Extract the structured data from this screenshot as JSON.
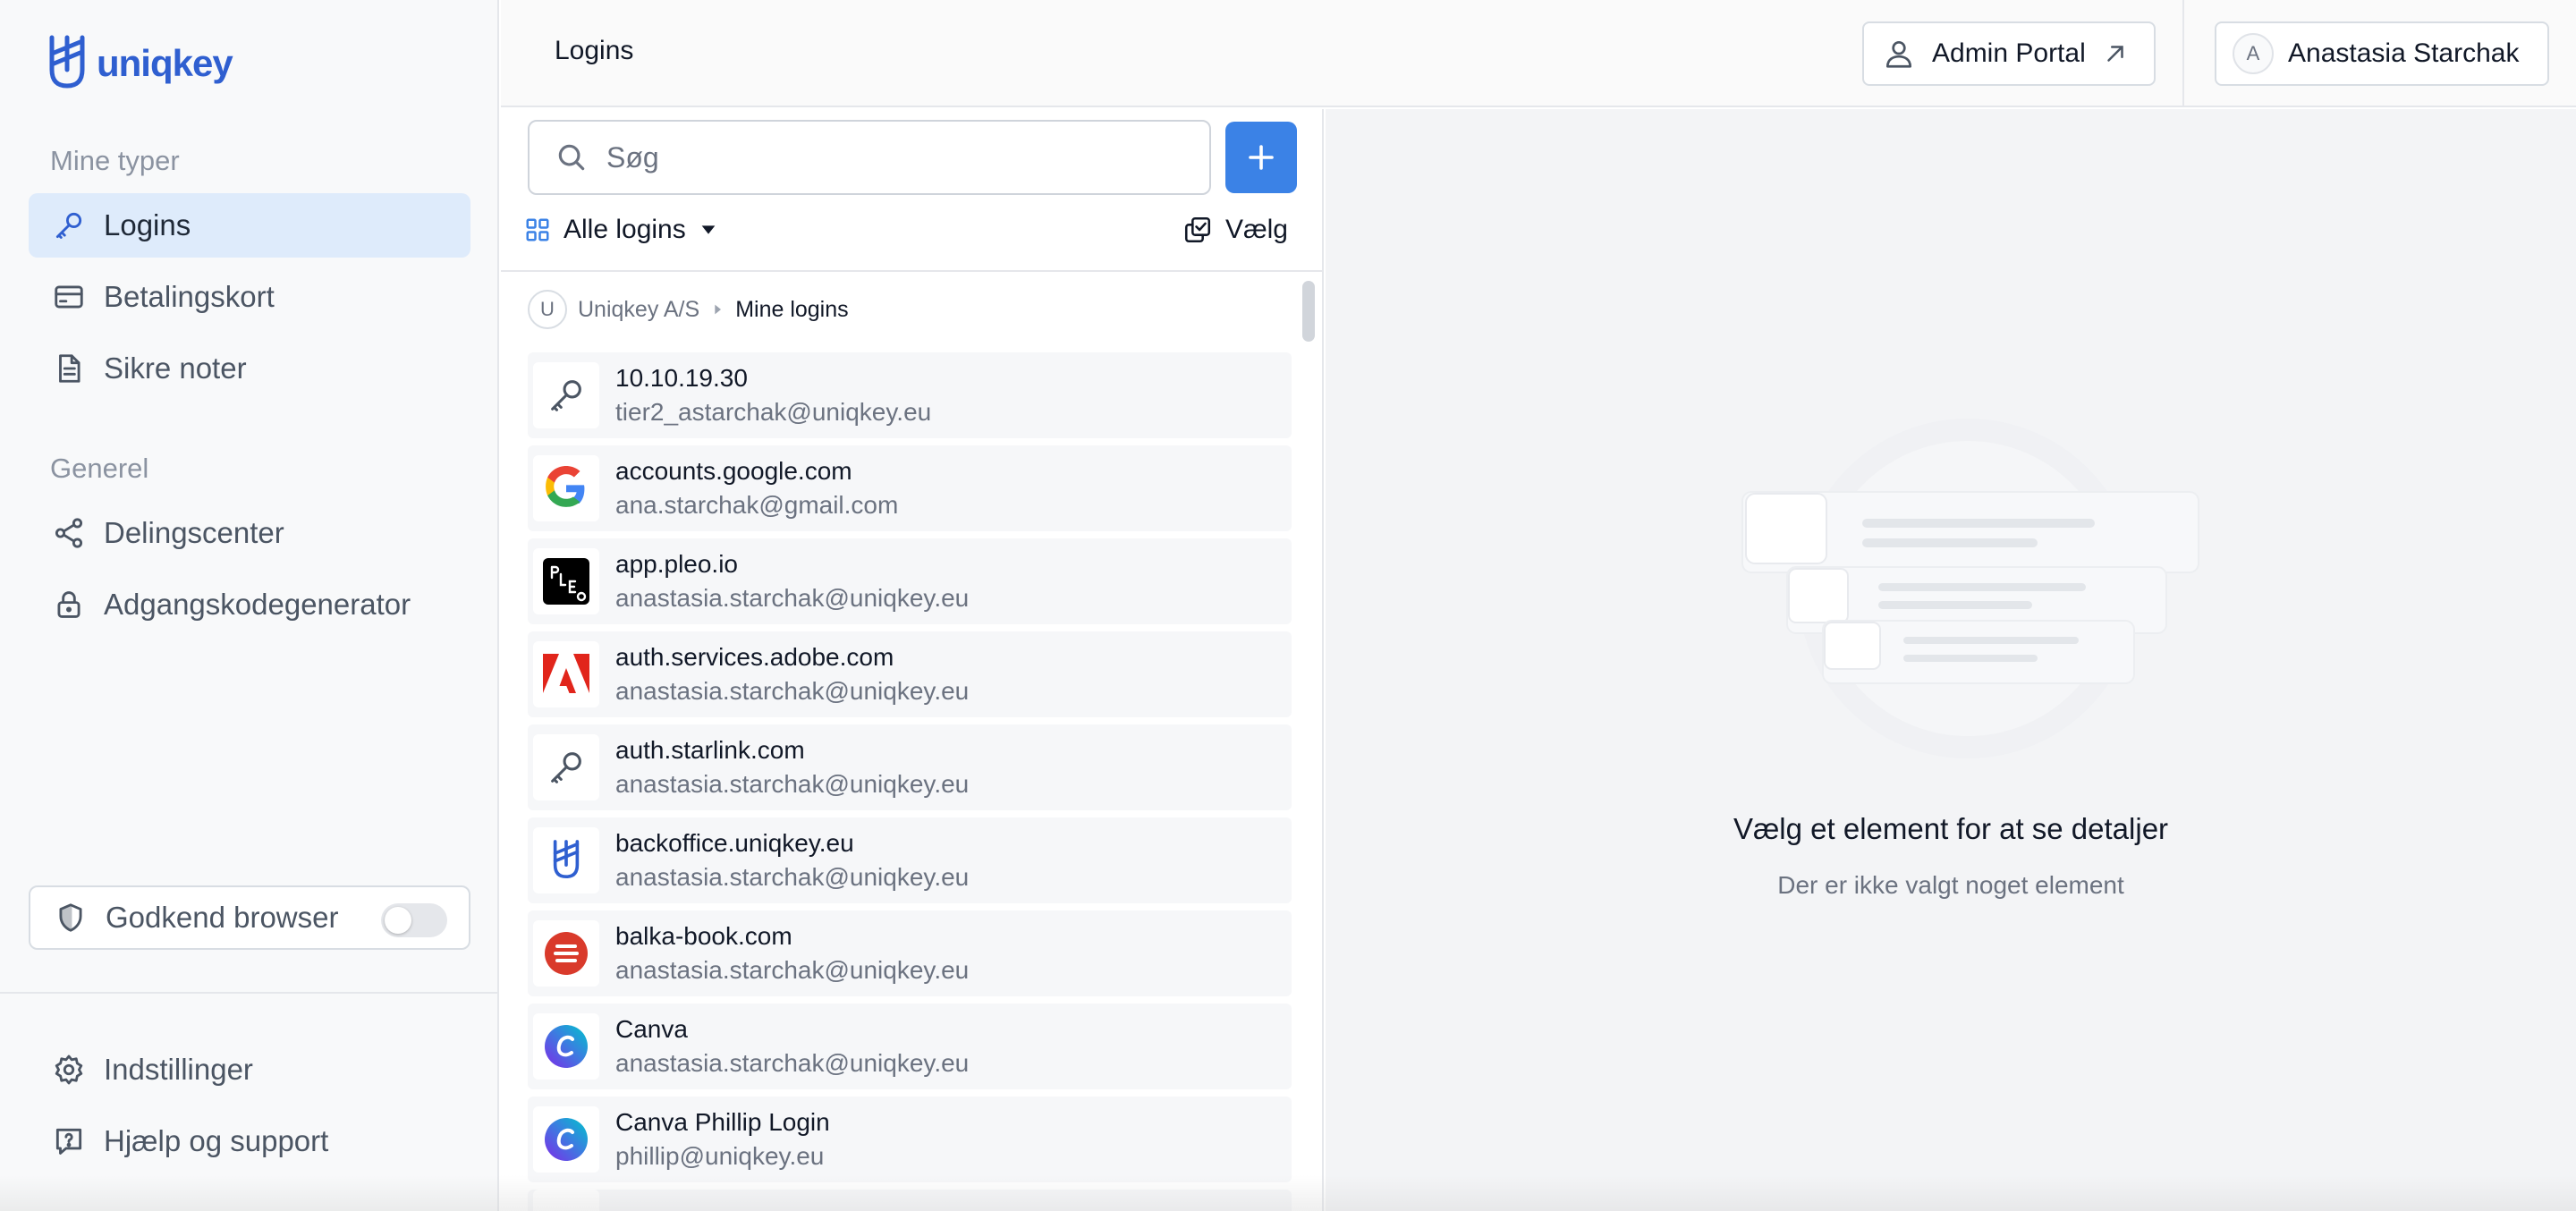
{
  "brand": {
    "name": "uniqkey",
    "color": "#2f5fd0",
    "accent": "#3b82e6"
  },
  "sidebar": {
    "section_my_types": "Mine typer",
    "section_general": "Generel",
    "items": [
      {
        "label": "Logins",
        "icon": "key-icon",
        "active": true
      },
      {
        "label": "Betalingskort",
        "icon": "credit-card-icon"
      },
      {
        "label": "Sikre noter",
        "icon": "document-icon"
      },
      {
        "label": "Delingscenter",
        "icon": "share-icon"
      },
      {
        "label": "Adgangskodegenerator",
        "icon": "lock-icon"
      }
    ],
    "approve_browser": {
      "label": "Godkend browser",
      "enabled": false
    },
    "settings_label": "Indstillinger",
    "help_label": "Hjælp og support"
  },
  "header": {
    "title": "Logins",
    "admin_portal_label": "Admin Portal",
    "user": {
      "initial": "A",
      "name": "Anastasia Starchak"
    }
  },
  "list": {
    "search_placeholder": "Søg",
    "filter_label": "Alle logins",
    "select_label": "Vælg",
    "breadcrumb": {
      "initial": "U",
      "org": "Uniqkey A/S",
      "current": "Mine logins"
    },
    "items": [
      {
        "title": "10.10.19.30",
        "subtitle": "tier2_astarchak@uniqkey.eu",
        "icon": "key-icon"
      },
      {
        "title": "accounts.google.com",
        "subtitle": "ana.starchak@gmail.com",
        "icon": "google-icon"
      },
      {
        "title": "app.pleo.io",
        "subtitle": "anastasia.starchak@uniqkey.eu",
        "icon": "pleo-icon"
      },
      {
        "title": "auth.services.adobe.com",
        "subtitle": "anastasia.starchak@uniqkey.eu",
        "icon": "adobe-icon"
      },
      {
        "title": "auth.starlink.com",
        "subtitle": "anastasia.starchak@uniqkey.eu",
        "icon": "key-icon"
      },
      {
        "title": "backoffice.uniqkey.eu",
        "subtitle": "anastasia.starchak@uniqkey.eu",
        "icon": "uniqkey-icon"
      },
      {
        "title": "balka-book.com",
        "subtitle": "anastasia.starchak@uniqkey.eu",
        "icon": "balka-icon"
      },
      {
        "title": "Canva",
        "subtitle": "anastasia.starchak@uniqkey.eu",
        "icon": "canva-icon"
      },
      {
        "title": "Canva Phillip Login",
        "subtitle": "phillip@uniqkey.eu",
        "icon": "canva-icon"
      }
    ]
  },
  "detail": {
    "empty_title": "Vælg et element for at se detaljer",
    "empty_subtitle": "Der er ikke valgt noget element"
  }
}
